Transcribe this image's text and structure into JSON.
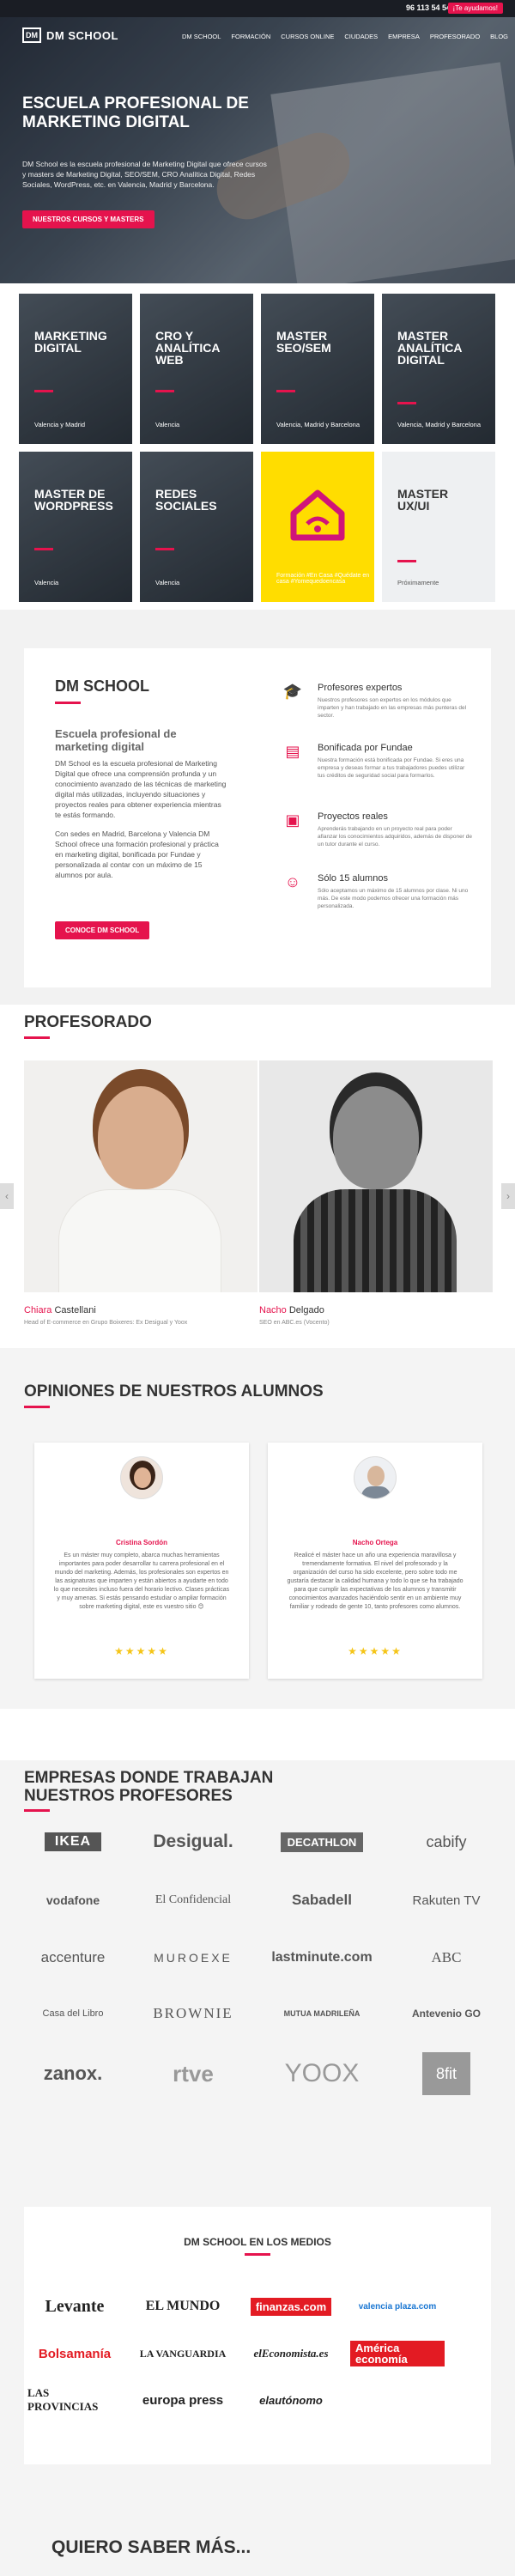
{
  "topbar": {
    "phone": "96 113 54 54",
    "help": "¡Te ayudamos!"
  },
  "header": {
    "logo_mark": "DM",
    "logo_text": "DM SCHOOL",
    "nav": [
      "DM SCHOOL",
      "FORMACIÓN",
      "CURSOS ONLINE",
      "CIUDADES",
      "EMPRESA",
      "PROFESORADO",
      "BLOG"
    ]
  },
  "hero": {
    "title": "ESCUELA PROFESIONAL DE MARKETING DIGITAL",
    "text": "DM School es la escuela profesional de Marketing Digital que ofrece cursos y masters de Marketing Digital, SEO/SEM, CRO Analítica Digital, Redes Sociales, WordPress, etc. en Valencia, Madrid y Barcelona.",
    "button": "NUESTROS CURSOS Y MASTERS"
  },
  "courses": [
    {
      "title": "MARKETING DIGITAL",
      "loc": "Valencia y Madrid"
    },
    {
      "title": "CRO Y ANALÍTICA WEB",
      "loc": "Valencia"
    },
    {
      "title": "MASTER SEO/SEM",
      "loc": "Valencia, Madrid y Barcelona"
    },
    {
      "title": "MASTER ANALÍTICA DIGITAL",
      "loc": "Valencia, Madrid y Barcelona"
    },
    {
      "title": "MASTER DE WORDPRESS",
      "loc": "Valencia"
    },
    {
      "title": "REDES SOCIALES",
      "loc": "Valencia"
    },
    {
      "title": "",
      "loc": "Formación #En Casa #Quédate en casa #Yomequedoencasa"
    },
    {
      "title": "MASTER UX/UI",
      "loc": "Próximamente"
    }
  ],
  "about": {
    "title": "DM SCHOOL",
    "subtitle": "Escuela profesional de marketing digital",
    "body1": "DM School es la escuela profesional de Marketing Digital que ofrece una comprensión profunda y un conocimiento avanzado de las técnicas de marketing digital más utilizadas, incluyendo situaciones y proyectos reales para obtener experiencia mientras te estás formando.",
    "body2": "Con sedes en Madrid, Barcelona y Valencia DM School ofrece una formación profesional y práctica en marketing digital, bonificada por Fundae y personalizada al contar con un máximo de 15 alumnos por aula.",
    "button": "CONOCE DM SCHOOL",
    "features": [
      {
        "title": "Profesores expertos",
        "text": "Nuestros profesores son expertos en los módulos que imparten y han trabajado en las empresas más punteras del sector.",
        "icon": "graduation-cap-icon"
      },
      {
        "title": "Bonificada por Fundae",
        "text": "Nuestra formación está bonificada por Fundae. Si eres una empresa y deseas formar a tus trabajadores puedes utilizar tus créditos de seguridad social para formarlos.",
        "icon": "fundae-icon"
      },
      {
        "title": "Proyectos reales",
        "text": "Aprenderás trabajando en un proyecto real para poder afianzar los conocimientos adquiridos, además de disponer de un tutor durante el curso.",
        "icon": "briefcase-icon"
      },
      {
        "title": "Sólo 15 alumnos",
        "text": "Sólo aceptamos un máximo de 15 alumnos por clase. Ni uno más. De este modo podemos ofrecer una formación más personalizada.",
        "icon": "students-icon"
      }
    ]
  },
  "teachers": {
    "title": "PROFESORADO",
    "list": [
      {
        "first": "Chiara",
        "last": "Castellani",
        "role": "Head of E-commerce en Grupo Boixeres: Ex Desigual y Yoox"
      },
      {
        "first": "Nacho",
        "last": "Delgado",
        "role": "SEO en ABC.es (Vocento)"
      }
    ]
  },
  "testimonials": {
    "title": "OPINIONES DE NUESTROS ALUMNOS",
    "list": [
      {
        "name": "Cristina Sordón",
        "text": "Es un máster muy completo, abarca muchas herramientas importantes para poder desarrollar tu carrera profesional en el mundo del marketing. Además, los profesionales son expertos en las asignaturas que imparten y están abiertos a ayudarte en todo lo que necesites incluso fuera del horario lectivo. Clases prácticas y muy amenas. Si estás pensando estudiar o ampliar formación sobre marketing digital, este es vuestro sitio 😊",
        "stars": "★★★★★"
      },
      {
        "name": "Nacho Ortega",
        "text": "Realicé el máster hace un año una experiencia maravillosa y tremendamente formativa. El nivel del profesorado y la organización del curso ha sido excelente, pero sobre todo me gustaría destacar la calidad humana y todo lo que se ha trabajado para que cumplir las expectativas de los alumnos y transmitir conocimientos avanzados haciéndolo sentir en un ambiente muy familiar y rodeado de gente 10, tanto profesores como alumnos.",
        "stars": "★★★★★"
      }
    ]
  },
  "companies": {
    "title": "EMPRESAS DONDE TRABAJAN NUESTROS PROFESORES",
    "logos": [
      "IKEA",
      "Desigual.",
      "DECATHLON",
      "cabify",
      "vodafone",
      "El Confidencial",
      "Sabadell",
      "Rakuten TV",
      "accenture",
      "MUROEXE",
      "lastminute.com",
      "ABC",
      "Casa del Libro",
      "BROWNIE",
      "MUTUA MADRILEÑA",
      "Antevenio GO",
      "zanox.",
      "rtve",
      "YOOX",
      "8fit"
    ]
  },
  "media": {
    "title": "DM SCHOOL EN LOS MEDIOS",
    "logos": [
      "Levante",
      "EL MUNDO",
      "finanzas.com",
      "valencia plaza.com",
      "Bolsamanía",
      "LA VANGUARDIA",
      "elEconomista.es",
      "América economía",
      "LAS PROVINCIAS",
      "europa press",
      "elautónomo"
    ]
  },
  "footer": {
    "title": "QUIERO SABER MÁS..."
  },
  "colors": {
    "accent": "#e5134d",
    "dark": "#1a1d24"
  }
}
